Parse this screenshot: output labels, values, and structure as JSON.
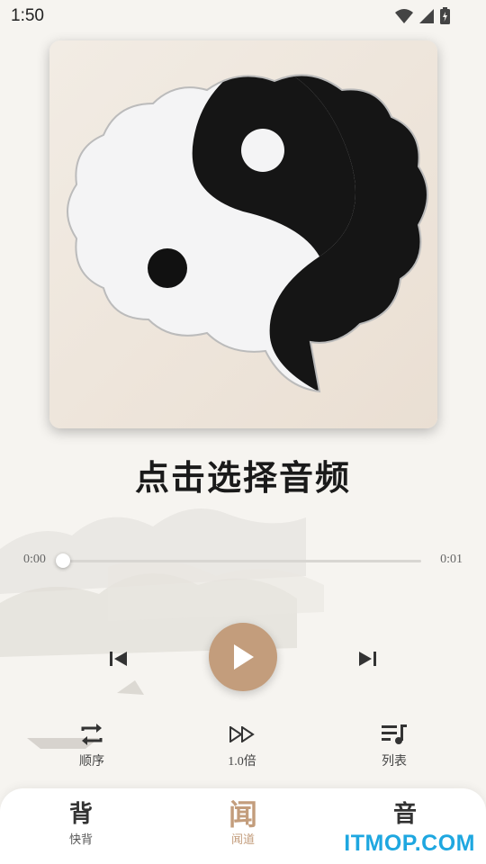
{
  "status_bar": {
    "time": "1:50"
  },
  "player": {
    "title": "点击选择音频",
    "time_current": "0:00",
    "time_total": "0:01",
    "progress": 0.0,
    "accent_color": "#c39d7c"
  },
  "options": {
    "mode_label": "顺序",
    "speed_label": "1.0倍",
    "list_label": "列表"
  },
  "bottom_nav": {
    "items": [
      {
        "glyph": "背",
        "label": "快背"
      },
      {
        "glyph": "闻",
        "label": "闻道"
      },
      {
        "glyph": "音",
        "label": ""
      }
    ]
  },
  "watermark": "ITMOP.COM"
}
